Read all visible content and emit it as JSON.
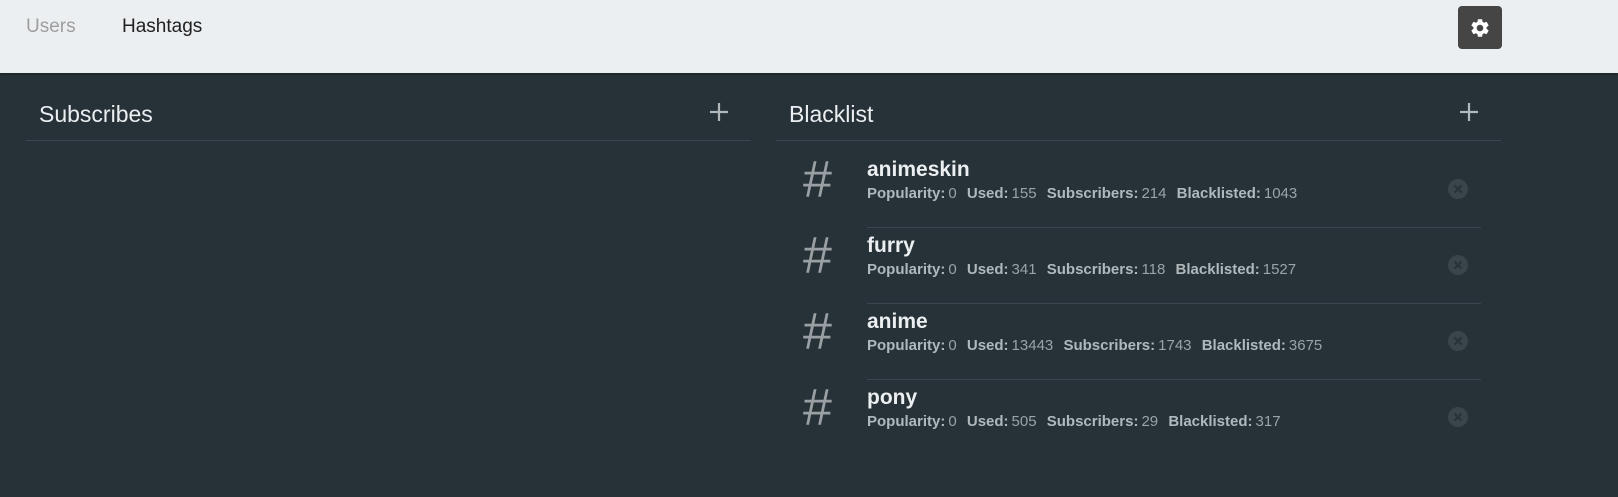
{
  "nav": {
    "tabs": [
      {
        "label": "Users"
      },
      {
        "label": "Hashtags"
      }
    ],
    "settings_icon": "gear-icon"
  },
  "subscribes": {
    "title": "Subscribes",
    "add_icon": "plus-icon",
    "items": []
  },
  "blacklist": {
    "title": "Blacklist",
    "add_icon": "plus-icon",
    "item_icon": "hash-icon",
    "remove_icon": "close-circle-icon",
    "stat_labels": {
      "popularity": "Popularity:",
      "used": "Used:",
      "subscribers": "Subscribers:",
      "blacklisted": "Blacklisted:"
    },
    "items": [
      {
        "name": "animeskin",
        "popularity": "0",
        "used": "155",
        "subscribers": "214",
        "blacklisted": "1043"
      },
      {
        "name": "furry",
        "popularity": "0",
        "used": "341",
        "subscribers": "118",
        "blacklisted": "1527"
      },
      {
        "name": "anime",
        "popularity": "0",
        "used": "13443",
        "subscribers": "1743",
        "blacklisted": "3675"
      },
      {
        "name": "pony",
        "popularity": "0",
        "used": "505",
        "subscribers": "29",
        "blacklisted": "317"
      }
    ]
  },
  "colors": {
    "background": "#263238",
    "topbar": "#eceff1",
    "settings_button": "#454545"
  }
}
